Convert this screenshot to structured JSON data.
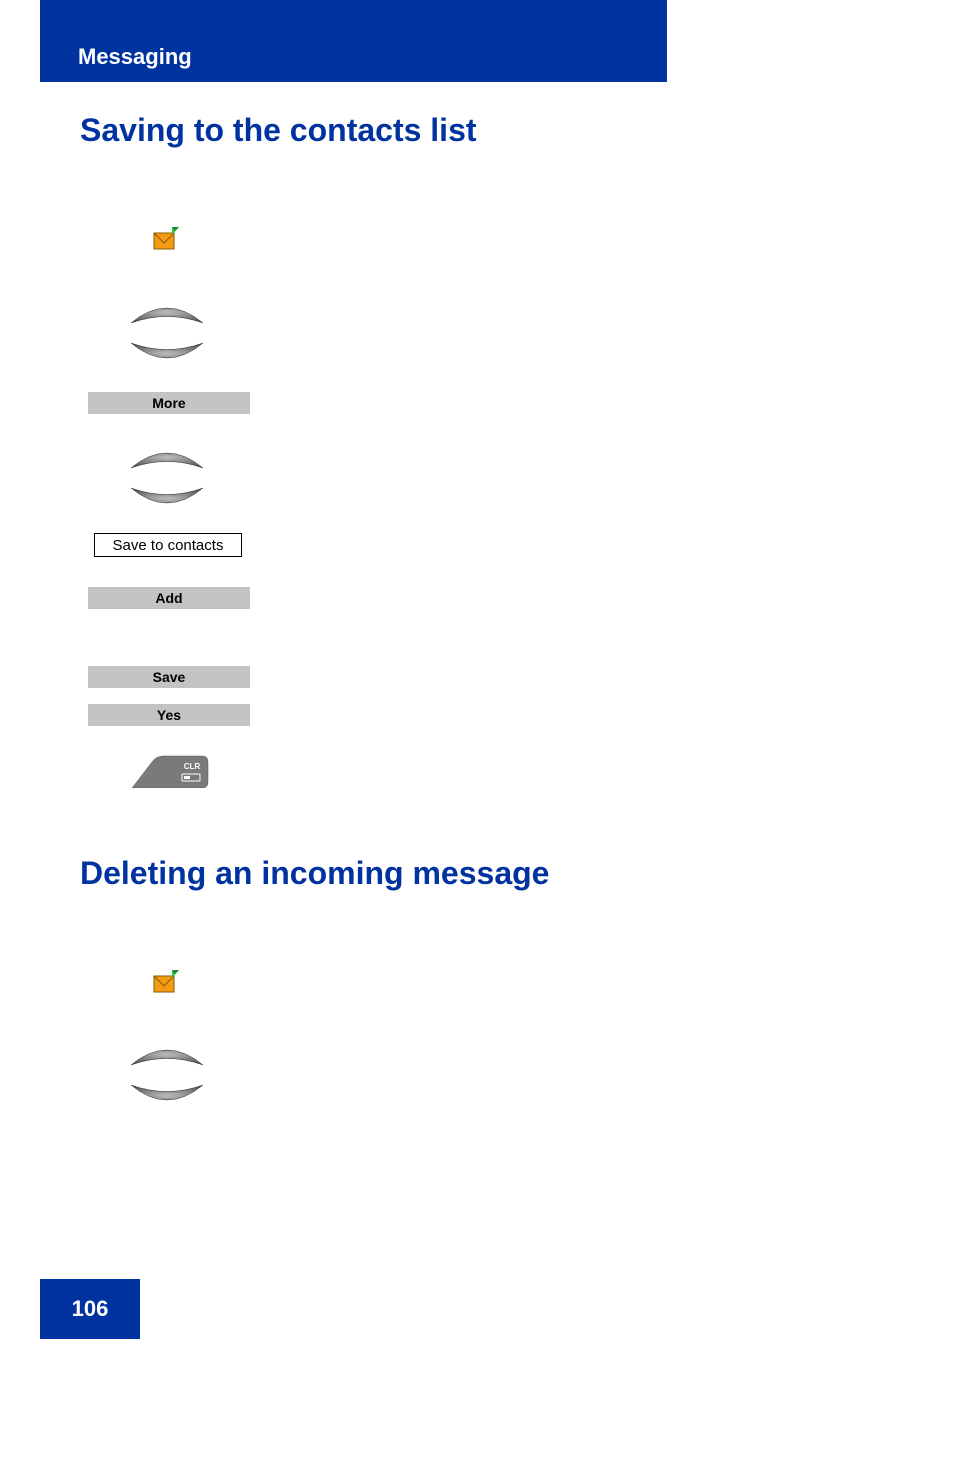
{
  "header": {
    "title": "Messaging"
  },
  "sections": {
    "saving": {
      "heading": "Saving to the contacts list"
    },
    "deleting": {
      "heading": "Deleting an incoming message"
    }
  },
  "buttons": {
    "more": "More",
    "save_to_contacts": "Save to contacts",
    "add": "Add",
    "save": "Save",
    "yes": "Yes"
  },
  "key_labels": {
    "clr": "CLR"
  },
  "icons": {
    "message": "message-icon",
    "nav": "nav-pad-icon",
    "clr": "clr-key-icon"
  },
  "page": {
    "number": "106"
  }
}
